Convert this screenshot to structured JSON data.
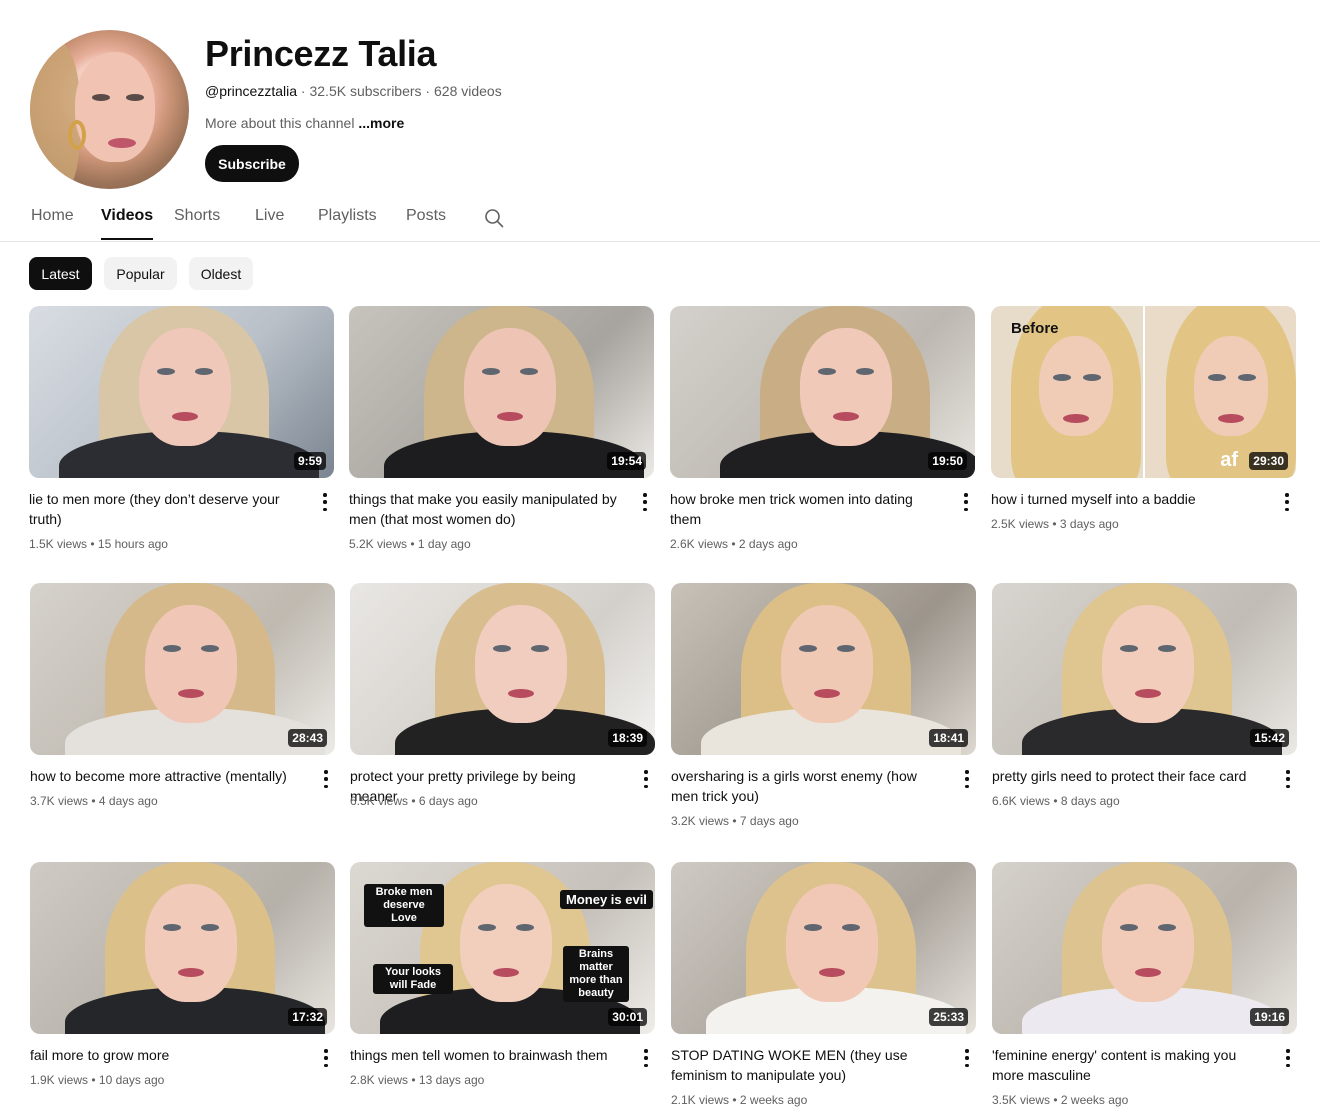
{
  "channel": {
    "name": "Princezz Talia",
    "handle": "@princezztalia",
    "subscribers": "32.5K subscribers",
    "videos_count": "628 videos",
    "separator": " · ",
    "about": "More about this channel",
    "about_more": "...more",
    "subscribe_label": "Subscribe"
  },
  "tabs": [
    {
      "label": "Home",
      "active": false
    },
    {
      "label": "Videos",
      "active": true
    },
    {
      "label": "Shorts",
      "active": false
    },
    {
      "label": "Live",
      "active": false
    },
    {
      "label": "Playlists",
      "active": false
    },
    {
      "label": "Posts",
      "active": false
    }
  ],
  "search_icon": "search-icon",
  "chips": [
    {
      "label": "Latest",
      "active": true
    },
    {
      "label": "Popular",
      "active": false
    },
    {
      "label": "Oldest",
      "active": false
    }
  ],
  "videos": [
    {
      "title": "lie to men more (they don’t deserve your truth)",
      "views": "1.5K views",
      "age": "15 hours ago",
      "duration": "9:59"
    },
    {
      "title": "things that make you easily manipulated by men (that most women do)",
      "views": "5.2K views",
      "age": "1 day ago",
      "duration": "19:54"
    },
    {
      "title": "how broke men trick women into dating them",
      "views": "2.6K views",
      "age": "2 days ago",
      "duration": "19:50"
    },
    {
      "title": "how i turned myself into a baddie",
      "views": "2.5K views",
      "age": "3 days ago",
      "duration": "29:30",
      "overlay": [
        "Before",
        "af"
      ]
    },
    {
      "title": "how to become more attractive (mentally)",
      "views": "3.7K views",
      "age": "4 days ago",
      "duration": "28:43"
    },
    {
      "title": "protect your pretty privilege by being meaner",
      "views": "6.5K views",
      "age": "6 days ago",
      "duration": "18:39"
    },
    {
      "title": "oversharing is a girls worst enemy (how men trick you)",
      "views": "3.2K views",
      "age": "7 days ago",
      "duration": "18:41"
    },
    {
      "title": "pretty girls need to protect their face card",
      "views": "6.6K views",
      "age": "8 days ago",
      "duration": "15:42"
    },
    {
      "title": "fail more to grow more",
      "views": "1.9K views",
      "age": "10 days ago",
      "duration": "17:32"
    },
    {
      "title": "things men tell women to brainwash them",
      "views": "2.8K views",
      "age": "13 days ago",
      "duration": "30:01",
      "overlay": [
        "Broke men deserve Love",
        "Money is evil",
        "Your looks will Fade",
        "Brains matter more than beauty"
      ]
    },
    {
      "title": "STOP DATING WOKE MEN (they use feminism to manipulate you)",
      "views": "2.1K views",
      "age": "2 weeks ago",
      "duration": "25:33"
    },
    {
      "title": "'feminine energy' content is making you more masculine",
      "views": "3.5K views",
      "age": "2 weeks ago",
      "duration": "19:16"
    }
  ],
  "stat_separator": " • ",
  "colors": {
    "accent": "#0f0f0f",
    "secondary_text": "#606060",
    "chip_bg": "#f2f2f2"
  }
}
